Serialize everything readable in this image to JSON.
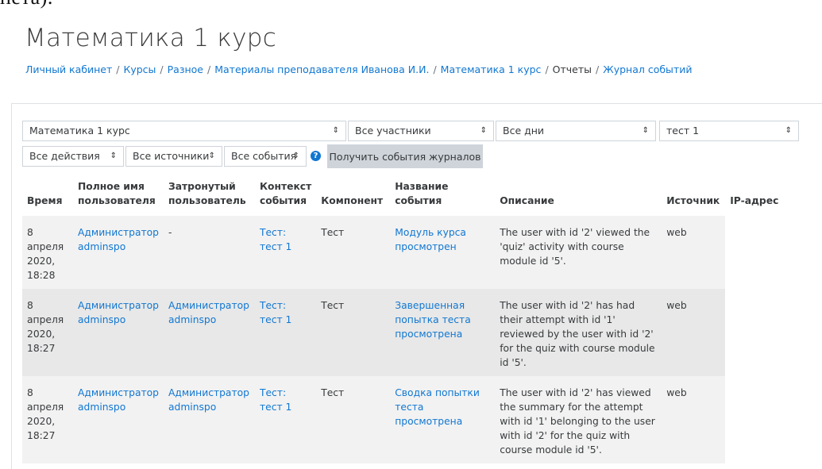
{
  "page_fragment": "пета).",
  "course_title": "Математика 1 курс",
  "breadcrumb": [
    {
      "label": "Личный кабинет",
      "link": true
    },
    {
      "label": "Курсы",
      "link": true
    },
    {
      "label": "Разное",
      "link": true
    },
    {
      "label": "Материалы преподавателя Иванова И.И.",
      "link": true
    },
    {
      "label": "Математика 1 курс",
      "link": true
    },
    {
      "label": "Отчеты",
      "link": false
    },
    {
      "label": "Журнал событий",
      "link": true
    }
  ],
  "filters": {
    "course": "Математика 1 курс",
    "participants": "Все участники",
    "days": "Все дни",
    "activity": "тест 1",
    "actions": "Все действия",
    "sources": "Все источники",
    "events": "Все события",
    "help_icon": "question-circle-icon",
    "submit_label": "Получить события журналов"
  },
  "table": {
    "headers": [
      "Время",
      "Полное имя пользователя",
      "Затронутый пользователь",
      "Контекст события",
      "Компонент",
      "Название события",
      "Описание",
      "Источник",
      "IP-адрес"
    ],
    "rows": [
      {
        "time": "8 апреля 2020, 18:28",
        "user": "Администратор adminspo",
        "affected": "-",
        "affected_link": false,
        "context": "Тест: тест 1",
        "component": "Тест",
        "event": "Модуль курса просмотрен",
        "description": "The user with id '2' viewed the 'quiz' activity with course module id '5'.",
        "origin": "web",
        "ip": ""
      },
      {
        "time": "8 апреля 2020, 18:27",
        "user": "Администратор adminspo",
        "affected": "Администратор adminspo",
        "affected_link": true,
        "context": "Тест: тест 1",
        "component": "Тест",
        "event": "Завершенная попытка теста просмотрена",
        "description": "The user with id '2' has had their attempt with id '1' reviewed by the user with id '2' for the quiz with course module id '5'.",
        "origin": "web",
        "ip": ""
      },
      {
        "time": "8 апреля 2020, 18:27",
        "user": "Администратор adminspo",
        "affected": "Администратор adminspo",
        "affected_link": true,
        "context": "Тест: тест 1",
        "component": "Тест",
        "event": "Сводка попытки теста просмотрена",
        "description": "The user with id '2' has viewed the summary for the attempt with id '1' belonging to the user with id '2' for the quiz with course module id '5'.",
        "origin": "web",
        "ip": ""
      }
    ]
  }
}
